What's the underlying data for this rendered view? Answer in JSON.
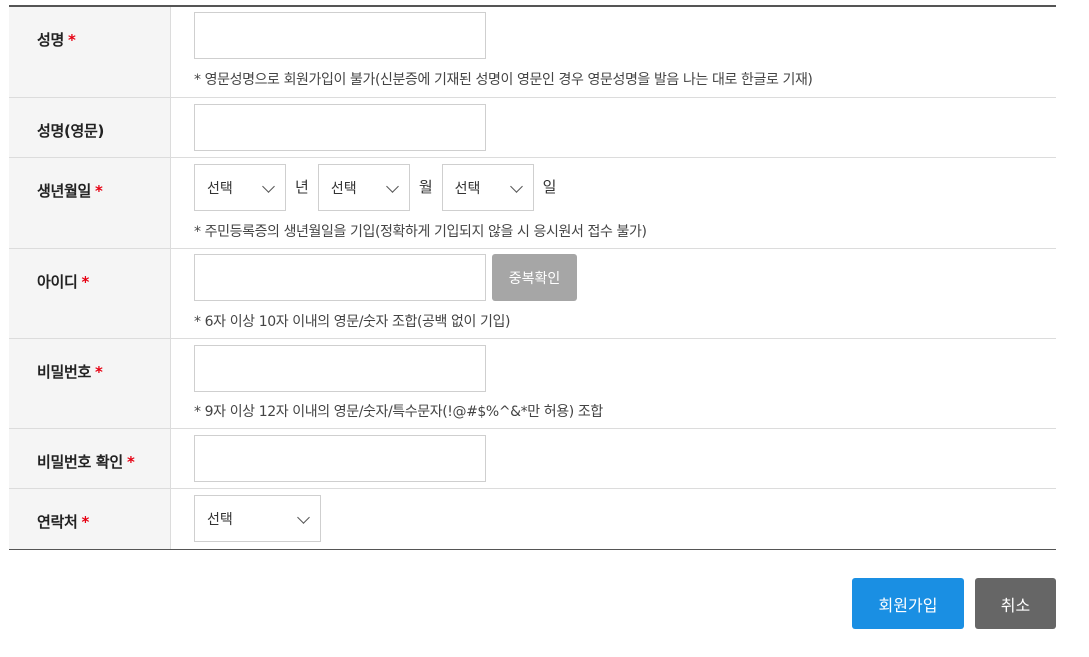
{
  "form": {
    "rows": [
      {
        "label": "성명",
        "required": "*",
        "note": "* 영문성명으로 회원가입이 불가(신분증에 기재된 성명이 영문인 경우 영문성명을 발음 나는 대로 한글로 기재)"
      },
      {
        "label": "성명(영문)"
      },
      {
        "label": "생년월일",
        "required": "*",
        "note": "* 주민등록증의 생년월일을 기입(정확하게 기입되지 않을 시 응시원서 접수 불가)"
      },
      {
        "label": "아이디",
        "required": "*",
        "note": "* 6자 이상 10자 이내의 영문/숫자 조합(공백 없이 기입)"
      },
      {
        "label": "비밀번호",
        "required": "*",
        "note": "* 9자 이상 12자 이내의 영문/숫자/특수문자(!@#$%^&*만 허용) 조합"
      },
      {
        "label": "비밀번호 확인",
        "required": "*"
      },
      {
        "label": "연락처",
        "required": "*"
      }
    ],
    "birth": {
      "year_select": "선택",
      "year_unit": "년",
      "month_select": "선택",
      "month_unit": "월",
      "day_select": "선택",
      "day_unit": "일"
    },
    "id_check_button": "중복확인",
    "contact_select": "선택"
  },
  "actions": {
    "join_label": "회원가입",
    "cancel_label": "취소"
  },
  "colors": {
    "required": "#e60012",
    "primary_button": "#1a8fe3",
    "cancel_button": "#666666",
    "id_check_button": "#a6a6a6"
  },
  "icons": {
    "select_arrow": "chevron-down-icon"
  }
}
